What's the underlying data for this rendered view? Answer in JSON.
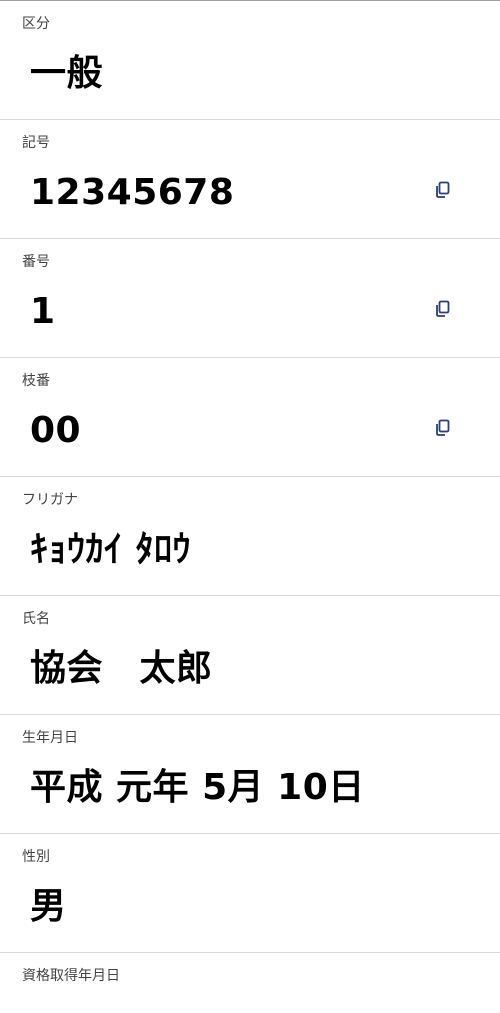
{
  "fields": [
    {
      "label": "区分",
      "value": "一般",
      "copyable": false
    },
    {
      "label": "記号",
      "value": "12345678",
      "copyable": true
    },
    {
      "label": "番号",
      "value": "1",
      "copyable": true
    },
    {
      "label": "枝番",
      "value": "00",
      "copyable": true
    },
    {
      "label": "フリガナ",
      "value": "ｷｮｳｶｲ ﾀﾛｳ",
      "copyable": false
    },
    {
      "label": "氏名",
      "value": "協会　太郎",
      "copyable": false
    },
    {
      "label": "生年月日",
      "value": "平成 元年 5月 10日",
      "copyable": false
    },
    {
      "label": "性別",
      "value": "男",
      "copyable": false
    },
    {
      "label": "資格取得年月日",
      "value": "",
      "copyable": false
    }
  ],
  "icons": {
    "copy": "copy-icon"
  },
  "colors": {
    "copy_icon": "#2b3f78",
    "divider": "#d9d9d9",
    "label": "#444444",
    "value": "#000000"
  }
}
